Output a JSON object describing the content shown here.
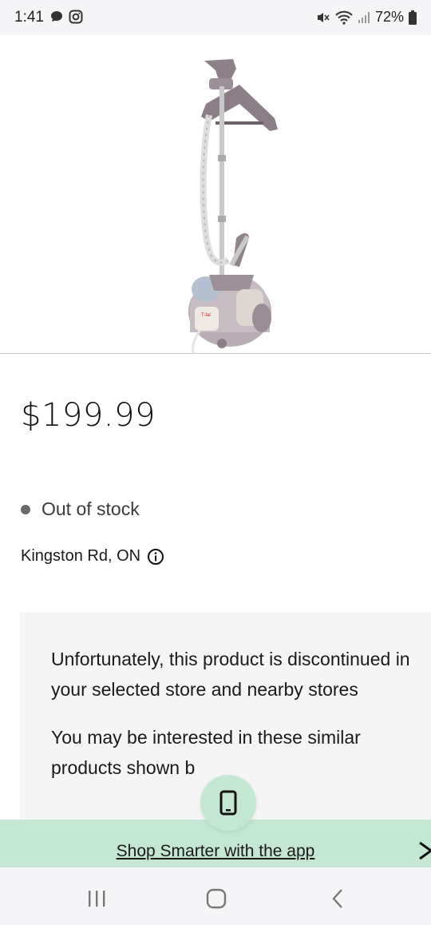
{
  "status_bar": {
    "time": "1:41",
    "battery": "72%",
    "icons": [
      "chat-bubble-icon",
      "instagram-icon",
      "mute-icon",
      "wifi-icon",
      "signal-icon",
      "battery-icon"
    ]
  },
  "product": {
    "image_alt": "garment-steamer-image",
    "price": "$199.99",
    "stock_status": "Out of stock",
    "store": "Kingston Rd, ON"
  },
  "notice": {
    "message": "Unfortunately, this product is discontinued in your selected store and nearby stores",
    "sub_message": "You may be interested in these similar products shown b"
  },
  "app_banner": {
    "label": "Shop Smarter with the app",
    "close": "✕"
  },
  "colors": {
    "banner": "#c4e7d4",
    "notice_bg": "#f5f5f5",
    "stock_dot": "#6b6b6b"
  }
}
